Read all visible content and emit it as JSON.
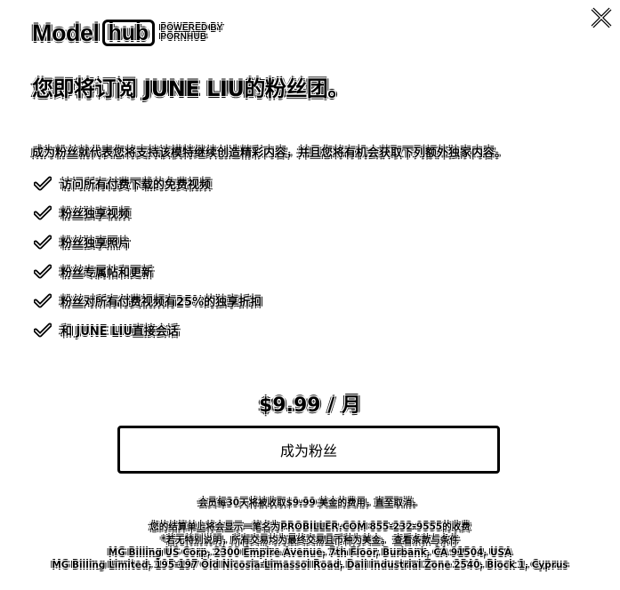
{
  "logo": {
    "model": "Model",
    "hub": "hub",
    "powered_line1": "POWERED BY",
    "powered_line2": "PORNHUB"
  },
  "close": {
    "icon": "close-icon"
  },
  "headline": "您即将订阅 JUNE LIU的粉丝团。",
  "intro": "成为粉丝就代表您将支持该模特继续创造精彩内容，并且您将有机会获取下列额外独家内容。",
  "benefits": [
    {
      "icon": "check-icon",
      "label": "访问所有付费下载的免费视频"
    },
    {
      "icon": "check-icon",
      "label": "粉丝独享视频"
    },
    {
      "icon": "check-icon",
      "label": "粉丝独享照片"
    },
    {
      "icon": "check-icon",
      "label": "粉丝专属帖和更新"
    },
    {
      "icon": "check-icon",
      "label": "粉丝对所有付费视频有25%的独享折扣"
    },
    {
      "icon": "check-icon",
      "label": "和 JUNE LIU直接会话"
    }
  ],
  "price": "$9.99 / 月",
  "cta_label": "成为粉丝",
  "renewal_note": "会员每30天将被收取$9.99 美金的费用，直至取消。",
  "fineprint": {
    "line1": "您的结算单上将会显示一笔名为PROBILLER.COM 855-232-9555的收费",
    "line2": "*若无特别说明，所有交易均为最终交易且币种为美金。 查看条款与条件",
    "line3": "MG Billing US Corp, 2300 Empire Avenue, 7th Floor, Burbank, CA 91504, USA",
    "line4": "MG Billing Limited, 195-197 Old Nicosia-Limassol Road, Dali Industrial Zone 2540, Block 1, Cyprus"
  },
  "colors": {
    "background": "#ffffff",
    "foreground": "#000000"
  }
}
